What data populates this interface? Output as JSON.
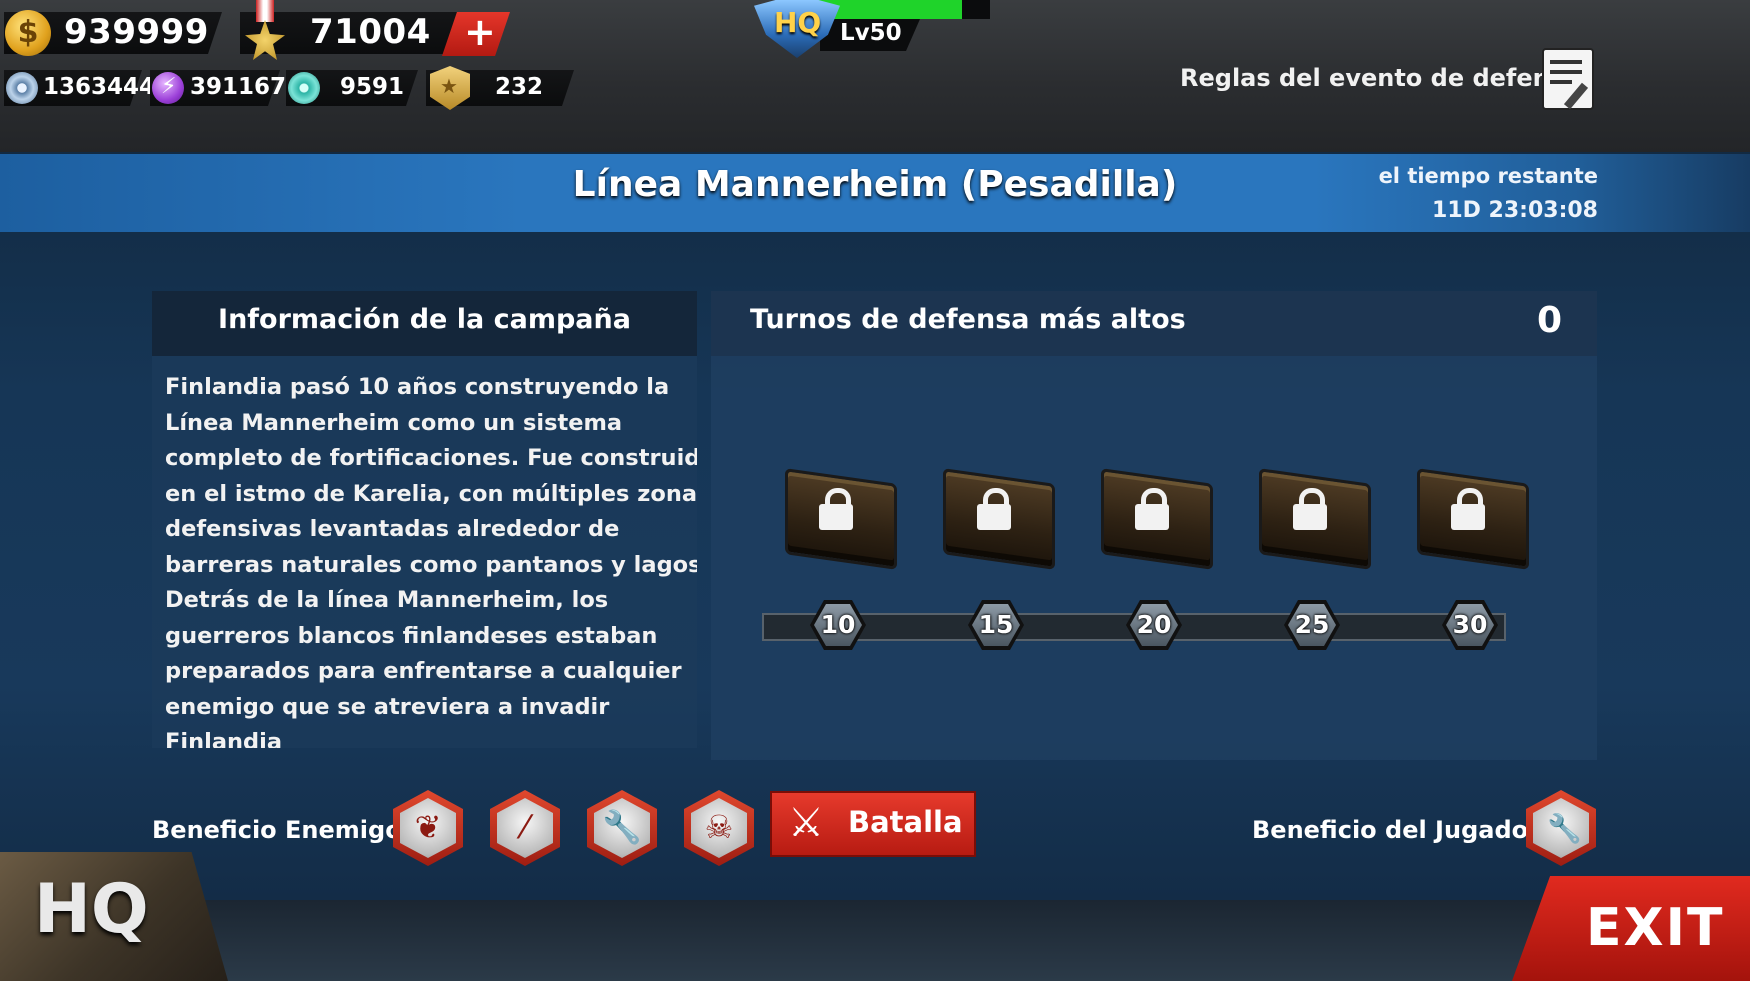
{
  "resources": {
    "gold": "939999",
    "medals": "71004",
    "gears": "1363444",
    "energy": "391167",
    "parts": "9591",
    "badges": "232"
  },
  "hq": {
    "badge": "HQ",
    "level": "Lv50",
    "xp_fraction": 0.85
  },
  "rules_link": "Reglas del evento de defensa",
  "event": {
    "title": "Línea Mannerheim (Pesadilla)",
    "time_label": "el tiempo restante",
    "time_value": "11D 23:03:08"
  },
  "campaign": {
    "header": "Información de la campaña",
    "lines": [
      "Finlandia pasó 10 años construyendo la",
      "Línea Mannerheim como un sistema",
      "completo de fortificaciones. Fue construido",
      "en el istmo de Karelia, con múltiples zonas",
      "defensivas levantadas alrededor de",
      "barreras naturales como pantanos y lagos.",
      "Detrás de la línea Mannerheim, los",
      "guerreros blancos finlandeses estaban",
      "preparados para enfrentarse a cualquier",
      "enemigo que se atreviera a invadir",
      "Finlandia"
    ]
  },
  "defense": {
    "header": "Turnos de defensa más altos",
    "score": "0",
    "milestones": [
      "10",
      "15",
      "20",
      "25",
      "30"
    ]
  },
  "enemy_buff_label": "Beneficio Enemigo",
  "enemy_buffs": [
    "wings-icon",
    "bullet-icon",
    "vehicle-repair-icon",
    "skull-icon"
  ],
  "battle_label": "Batalla",
  "player_buff_label": "Beneficio del Jugador",
  "player_buffs": [
    "vehicle-repair-icon"
  ],
  "hq_corner_label": "HQ",
  "exit_label": "EXIT",
  "colors": {
    "accent_red": "#d2261b",
    "banner_blue": "#2a76be",
    "xp_green": "#1fd32a"
  }
}
